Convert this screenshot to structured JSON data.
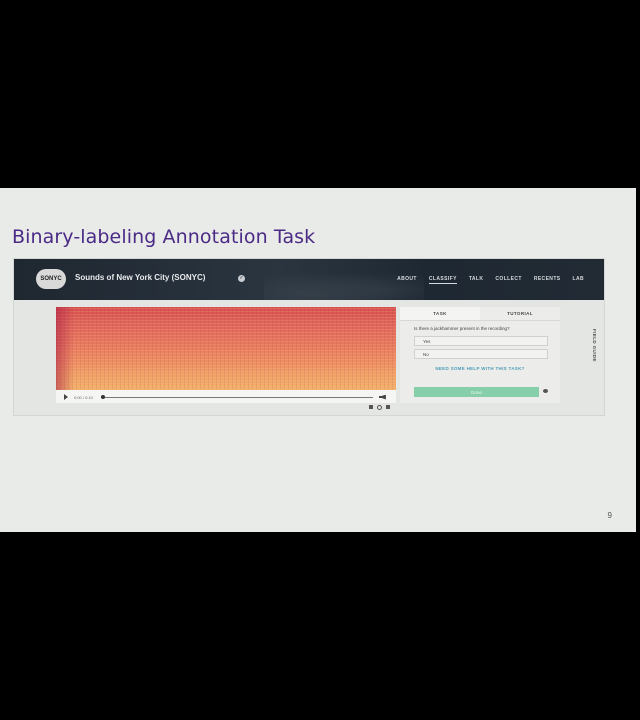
{
  "slide": {
    "title": "Binary-labeling Annotation Task",
    "page_number": "9"
  },
  "app": {
    "logo_text": "SONYC",
    "project_name": "Sounds of New York City (SONYC)",
    "nav": [
      "ABOUT",
      "CLASSIFY",
      "TALK",
      "COLLECT",
      "RECENTS",
      "LAB"
    ],
    "active_nav": "CLASSIFY"
  },
  "player": {
    "time": "0:00 / 0:10"
  },
  "task": {
    "tabs": [
      "TASK",
      "TUTORIAL"
    ],
    "question": "Is there a jackhammer present in the recording?",
    "answers": [
      "Yes",
      "No"
    ],
    "help_link": "NEED SOME HELP WITH THIS TASK?",
    "done_label": "Done",
    "field_guide_label": "FIELD GUIDE"
  }
}
